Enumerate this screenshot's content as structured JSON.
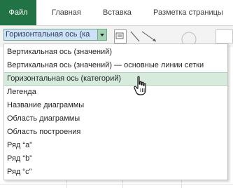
{
  "ribbon": {
    "tabs": [
      {
        "label": "Файл"
      },
      {
        "label": "Главная"
      },
      {
        "label": "Вставка"
      },
      {
        "label": "Разметка страницы"
      }
    ],
    "colors": {
      "file_tab": "#217346",
      "combo_arrow": "#a5d3b6",
      "selection": "#cfe1f6",
      "hover": "#d6ebdc"
    }
  },
  "combo": {
    "value": "Горизонтальная ось (ка"
  },
  "dropdown": {
    "items": [
      {
        "label": "Вертикальная ось (значений)"
      },
      {
        "label": "Вертикальная ось (значений)  — основные линии сетки"
      },
      {
        "label": "Горизонтальная ось (категорий)",
        "state": "hover"
      },
      {
        "label": "Легенда"
      },
      {
        "label": "Название диаграммы"
      },
      {
        "label": "Область диаграммы"
      },
      {
        "label": "Область построения"
      },
      {
        "label": "Ряд “a”"
      },
      {
        "label": "Ряд “b”"
      },
      {
        "label": "Ряд “c”"
      }
    ]
  },
  "icons": [
    "shape-fill-icon",
    "line-shapes-icon",
    "shape-styles-icon",
    "pointer-hand-icon"
  ]
}
